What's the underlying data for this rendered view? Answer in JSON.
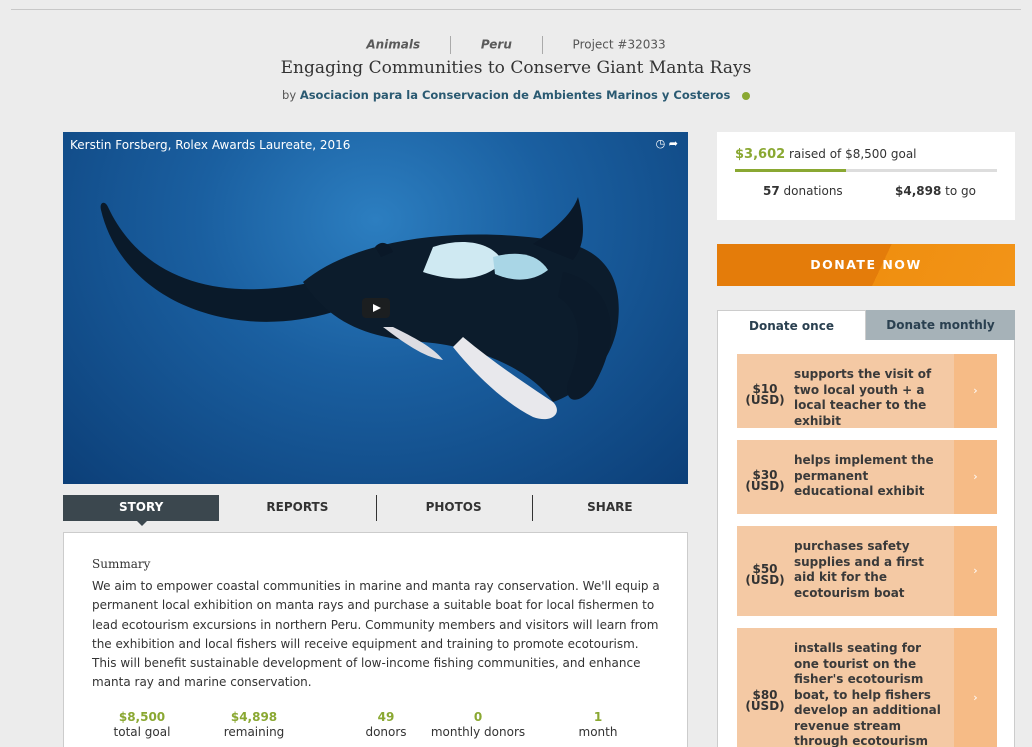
{
  "header": {
    "category1": "Animals",
    "category2": "Peru",
    "project_id": "Project #32033",
    "title": "Engaging Communities to Conserve Giant Manta Rays",
    "by": "by",
    "org": "Asociacion para la Conservacion de Ambientes Marinos y Costeros"
  },
  "video": {
    "caption": "Kerstin Forsberg, Rolex Awards Laureate, 2016",
    "icons": [
      "clock-icon",
      "share-arrow-icon",
      "play-icon"
    ]
  },
  "tabs": [
    "STORY",
    "REPORTS",
    "PHOTOS",
    "SHARE"
  ],
  "summary": {
    "heading": "Summary",
    "text": "We aim to empower coastal communities in marine and manta ray conservation. We'll equip a permanent local exhibition on manta rays and purchase a suitable boat for local fishermen to lead ecotourism excursions in northern Peru. Community members and visitors will learn from the exhibition and local fishers will receive equipment and training to promote ecotourism. This will benefit sustainable development of low-income fishing communities, and enhance manta ray and marine conservation.",
    "stats": [
      {
        "value": "$8,500",
        "label": "total goal"
      },
      {
        "value": "$4,898",
        "label": "remaining"
      },
      {
        "value": "49",
        "label": "donors"
      },
      {
        "value": "0",
        "label": "monthly donors"
      },
      {
        "value": "1",
        "label": "month"
      }
    ]
  },
  "goal": {
    "raised": "$3,602",
    "raised_text": "raised of $8,500 goal",
    "progress_fraction": 0.424,
    "donations_count": "57",
    "donations_label": "donations",
    "to_go_amount": "$4,898",
    "to_go_label": "to go"
  },
  "donate_button": "DONATE NOW",
  "donate_tabs": [
    "Donate once",
    "Donate monthly"
  ],
  "levels": [
    {
      "amount": "$10",
      "currency": "(USD)",
      "desc": "supports the visit of two local youth + a local teacher to the exhibit"
    },
    {
      "amount": "$30",
      "currency": "(USD)",
      "desc": "helps implement the permanent educational exhibit"
    },
    {
      "amount": "$50",
      "currency": "(USD)",
      "desc": "purchases safety supplies and a first aid kit for the ecotourism boat"
    },
    {
      "amount": "$80",
      "currency": "(USD)",
      "desc": "installs seating for one tourist on the fisher's ecotourism boat, to help fishers develop an additional revenue stream through ecotourism"
    }
  ],
  "colors": {
    "accent_green": "#8aa832",
    "donate_orange": "#e47c0a",
    "level_bg": "#f4c9a4",
    "dark_tab": "#3b474e"
  }
}
